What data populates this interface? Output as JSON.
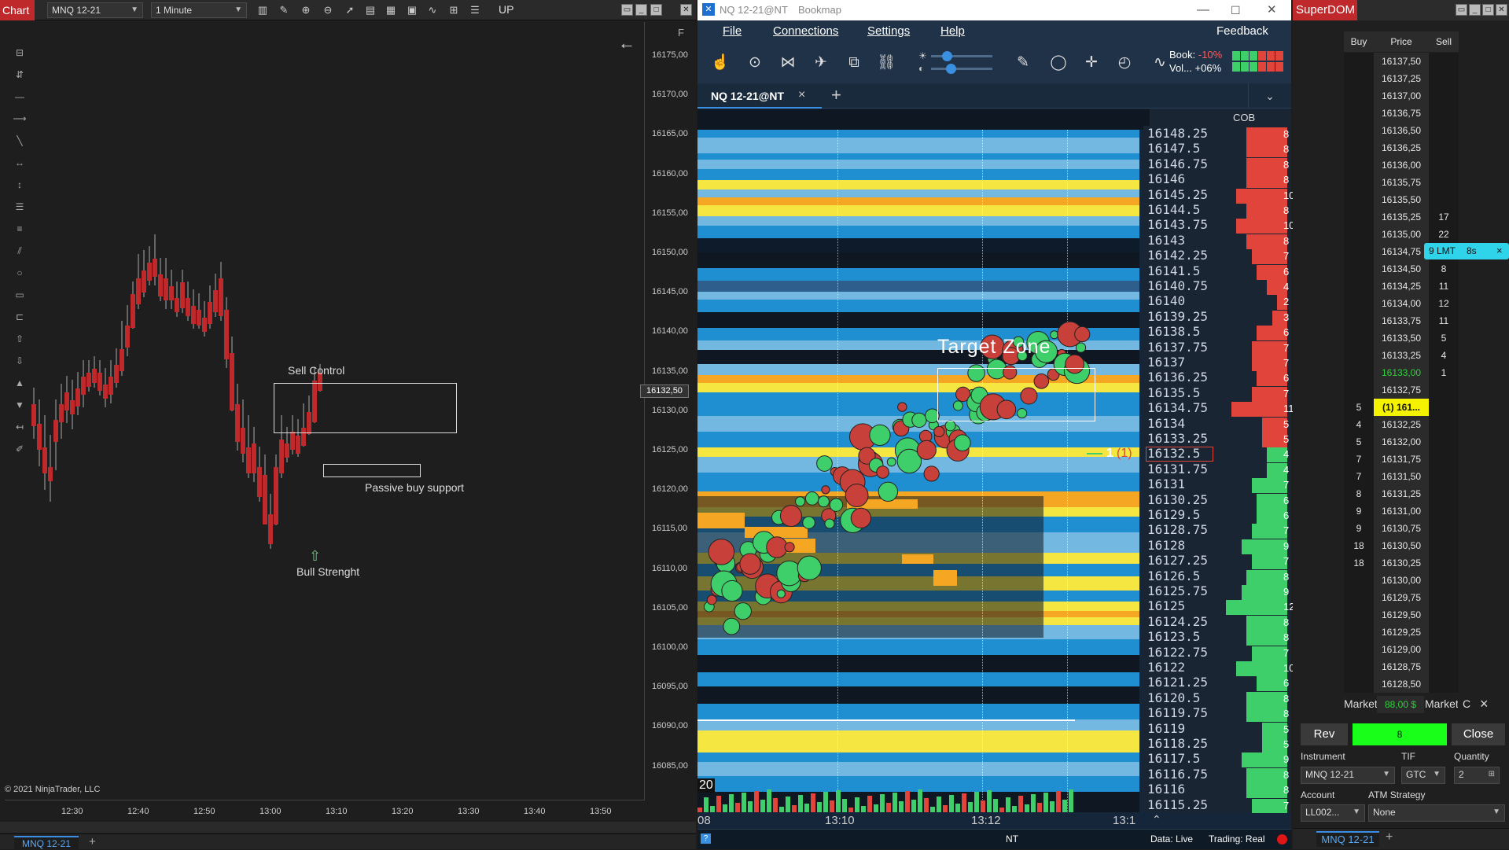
{
  "ninjatrader": {
    "window_title": "Chart",
    "instrument_select": "MNQ 12-21",
    "interval_select": "1 Minute",
    "toolbar_label": "UP",
    "f_label": "F",
    "back_arrow": "←",
    "copyright": "© 2021 NinjaTrader, LLC",
    "tab_label": "MNQ 12-21",
    "add_tab": "+",
    "current_price": "16132,50",
    "price_axis": [
      "16175,00",
      "16170,00",
      "16165,00",
      "16160,00",
      "16155,00",
      "16150,00",
      "16145,00",
      "16140,00",
      "16135,00",
      "16130,00",
      "16125,00",
      "16120,00",
      "16115,00",
      "16110,00",
      "16105,00",
      "16100,00",
      "16095,00",
      "16090,00",
      "16085,00"
    ],
    "time_axis": [
      "12:30",
      "12:40",
      "12:50",
      "13:00",
      "13:10",
      "13:20",
      "13:30",
      "13:40",
      "13:50"
    ],
    "annotations": {
      "sell_control": "Sell Control",
      "passive_buy": "Passive buy support",
      "bull_strength": "Bull Strenght"
    },
    "bull_color": "#2fa83a",
    "bear_color": "#c0292b"
  },
  "bookmap": {
    "window_title": "NQ 12-21@NT",
    "app_name": "Bookmap",
    "menu": [
      "File",
      "Connections",
      "Settings",
      "Help"
    ],
    "feedback": "Feedback",
    "book_label": "Book:",
    "book_pct": "-10%",
    "vol_label": "Vol...",
    "vol_pct": "+06%",
    "tab_label": "NQ 12-21@NT",
    "tab_close": "×",
    "add_tab": "+",
    "cob_label": "COB",
    "target_zone": "Target Zone",
    "position_marker": "1",
    "position_qty": "(1)",
    "volume_label": "20",
    "current_price": "16132.5",
    "price_ladder": [
      "16148.25",
      "16147.5",
      "16146.75",
      "16146",
      "16145.25",
      "16144.5",
      "16143.75",
      "16143",
      "16142.25",
      "16141.5",
      "16140.75",
      "16140",
      "16139.25",
      "16138.5",
      "16137.75",
      "16137",
      "16136.25",
      "16135.5",
      "16134.75",
      "16134",
      "16133.25",
      "16132.5",
      "16131.75",
      "16131",
      "16130.25",
      "16129.5",
      "16128.75",
      "16128",
      "16127.25",
      "16126.5",
      "16125.75",
      "16125",
      "16124.25",
      "16123.5",
      "16122.75",
      "16122",
      "16121.25",
      "16120.5",
      "16119.75",
      "16119",
      "16118.25",
      "16117.5",
      "16116.75",
      "16116",
      "16115.25"
    ],
    "cob_values": [
      "8",
      "8",
      "8",
      "8",
      "10",
      "8",
      "10",
      "8",
      "7",
      "6",
      "4",
      "2",
      "3",
      "6",
      "7",
      "7",
      "6",
      "7",
      "11",
      "5",
      "5",
      "4",
      "4",
      "7",
      "6",
      "6",
      "7",
      "9",
      "7",
      "8",
      "9",
      "12",
      "8",
      "8",
      "7",
      "10",
      "6",
      "8",
      "8",
      "5",
      "5",
      "9",
      "8",
      "8",
      "7"
    ],
    "time_axis": [
      "08",
      "13:10",
      "13:12",
      "13:1"
    ],
    "status_nt": "NT",
    "status_data": "Data: Live",
    "status_trading": "Trading: Real",
    "ask_color": "#e0443a",
    "bid_color": "#3ecf6a"
  },
  "superdom": {
    "window_title": "SuperDOM",
    "headers": [
      "Buy",
      "Price",
      "Sell"
    ],
    "rows": [
      {
        "buy": "",
        "price": "16137,50",
        "sell": ""
      },
      {
        "buy": "",
        "price": "16137,25",
        "sell": ""
      },
      {
        "buy": "",
        "price": "16137,00",
        "sell": ""
      },
      {
        "buy": "",
        "price": "16136,75",
        "sell": ""
      },
      {
        "buy": "",
        "price": "16136,50",
        "sell": ""
      },
      {
        "buy": "",
        "price": "16136,25",
        "sell": ""
      },
      {
        "buy": "",
        "price": "16136,00",
        "sell": ""
      },
      {
        "buy": "",
        "price": "16135,75",
        "sell": ""
      },
      {
        "buy": "",
        "price": "16135,50",
        "sell": ""
      },
      {
        "buy": "",
        "price": "16135,25",
        "sell": "17"
      },
      {
        "buy": "",
        "price": "16135,00",
        "sell": "22"
      },
      {
        "buy": "",
        "price": "16134,75",
        "sell": ""
      },
      {
        "buy": "",
        "price": "16134,50",
        "sell": "8"
      },
      {
        "buy": "",
        "price": "16134,25",
        "sell": "11"
      },
      {
        "buy": "",
        "price": "16134,00",
        "sell": "12"
      },
      {
        "buy": "",
        "price": "16133,75",
        "sell": "11"
      },
      {
        "buy": "",
        "price": "16133,50",
        "sell": "5"
      },
      {
        "buy": "",
        "price": "16133,25",
        "sell": "4"
      },
      {
        "buy": "",
        "price": "16133,00",
        "sell": "1"
      },
      {
        "buy": "",
        "price": "16132,75",
        "sell": ""
      },
      {
        "buy": "5",
        "price": "(1) 161...",
        "sell": ""
      },
      {
        "buy": "4",
        "price": "16132,25",
        "sell": ""
      },
      {
        "buy": "5",
        "price": "16132,00",
        "sell": ""
      },
      {
        "buy": "7",
        "price": "16131,75",
        "sell": ""
      },
      {
        "buy": "7",
        "price": "16131,50",
        "sell": ""
      },
      {
        "buy": "8",
        "price": "16131,25",
        "sell": ""
      },
      {
        "buy": "9",
        "price": "16131,00",
        "sell": ""
      },
      {
        "buy": "9",
        "price": "16130,75",
        "sell": ""
      },
      {
        "buy": "18",
        "price": "16130,50",
        "sell": ""
      },
      {
        "buy": "18",
        "price": "16130,25",
        "sell": ""
      },
      {
        "buy": "",
        "price": "16130,00",
        "sell": ""
      },
      {
        "buy": "",
        "price": "16129,75",
        "sell": ""
      },
      {
        "buy": "",
        "price": "16129,50",
        "sell": ""
      },
      {
        "buy": "",
        "price": "16129,25",
        "sell": ""
      },
      {
        "buy": "",
        "price": "16129,00",
        "sell": ""
      },
      {
        "buy": "",
        "price": "16128,75",
        "sell": ""
      },
      {
        "buy": "",
        "price": "16128,50",
        "sell": ""
      }
    ],
    "order_tag": {
      "qty": "9 LMT",
      "age": "8s",
      "close": "×"
    },
    "market_left": "Market",
    "pnl": "88,00 $",
    "market_right": "Market",
    "c_label": "C",
    "x_label": "×",
    "rev": "Rev",
    "position": "8",
    "close": "Close",
    "instrument_label": "Instrument",
    "instrument": "MNQ 12-21",
    "tif_label": "TIF",
    "tif": "GTC",
    "quantity_label": "Quantity",
    "quantity": "2",
    "account_label": "Account",
    "account": "LL002...",
    "atm_label": "ATM Strategy",
    "atm": "None",
    "tab_label": "MNQ 12-21",
    "add_tab": "+"
  }
}
